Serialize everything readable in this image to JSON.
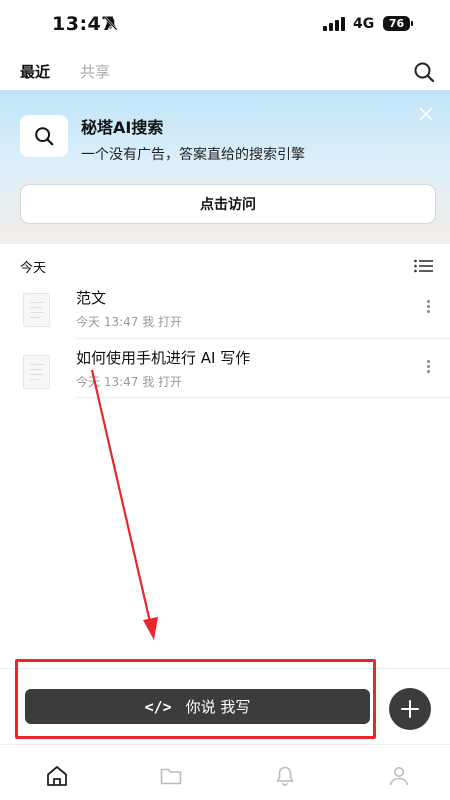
{
  "status_bar": {
    "time": "13:47",
    "network": "4G",
    "battery": "76"
  },
  "header": {
    "tabs": [
      {
        "label": "最近",
        "active": true
      },
      {
        "label": "共享",
        "active": false
      }
    ]
  },
  "banner": {
    "title": "秘塔AI搜索",
    "subtitle": "一个没有广告，答案直给的搜索引擎",
    "button_label": "点击访问"
  },
  "list": {
    "section_label": "今天",
    "documents": [
      {
        "title": "范文",
        "meta": "今天 13:47 我 打开"
      },
      {
        "title": "如何使用手机进行 AI 写作",
        "meta": "今天 13:47 我 打开"
      }
    ]
  },
  "action_bar": {
    "write_button_label": "你说 我写",
    "write_button_icon": "code-icon"
  },
  "bottom_nav": {
    "items": [
      "home-icon",
      "folder-icon",
      "bell-icon",
      "profile-icon"
    ]
  },
  "colors": {
    "accent_dark": "#3c3c3c",
    "annotation_red": "#e8262b",
    "banner_top": "#bfe4f7"
  }
}
